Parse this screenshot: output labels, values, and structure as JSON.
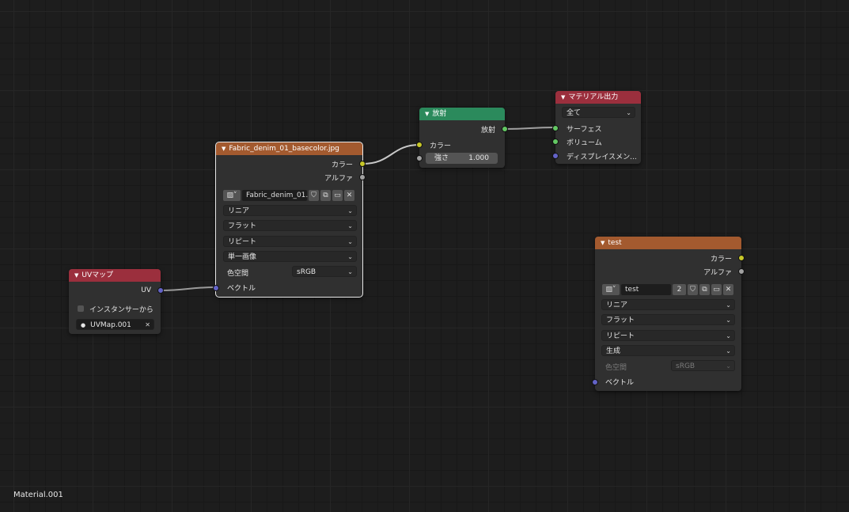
{
  "footer": {
    "material_name": "Material.001"
  },
  "colors": {
    "header_orange": "#a35a2f",
    "header_red": "#9b2f3d",
    "header_green": "#2b8a5c",
    "socket_color": "#c7c729",
    "socket_float": "#a1a1a1",
    "socket_shader": "#63c763",
    "socket_vector": "#6363c7"
  },
  "nodes": {
    "uvmap": {
      "title": "UVマップ",
      "out_uv": "UV",
      "from_instancer": "インスタンサーから",
      "uv_map_value": "UVMap.001"
    },
    "image_tex1": {
      "title": "Fabric_denim_01_basecolor.jpg",
      "out_color": "カラー",
      "out_alpha": "アルファ",
      "image_name": "Fabric_denim_01...",
      "interpolation": "リニア",
      "projection": "フラット",
      "extension": "リピート",
      "source": "単一画像",
      "colorspace_label": "色空間",
      "colorspace_value": "sRGB",
      "in_vector": "ベクトル"
    },
    "emission": {
      "title": "放射",
      "out_emission": "放射",
      "in_color": "カラー",
      "strength_label": "強さ",
      "strength_value": "1.000"
    },
    "material_output": {
      "title": "マテリアル出力",
      "target": "全て",
      "in_surface": "サーフェス",
      "in_volume": "ボリューム",
      "in_displacement": "ディスプレイスメン..."
    },
    "image_tex2": {
      "title": "test",
      "out_color": "カラー",
      "out_alpha": "アルファ",
      "image_name": "test",
      "users": "2",
      "interpolation": "リニア",
      "projection": "フラット",
      "extension": "リピート",
      "source": "生成",
      "colorspace_label": "色空間",
      "colorspace_value": "sRGB",
      "in_vector": "ベクトル"
    }
  }
}
